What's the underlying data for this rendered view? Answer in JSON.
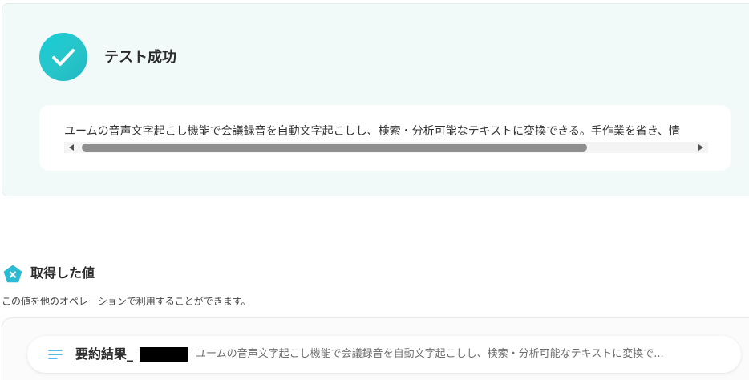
{
  "test_result": {
    "title": "テスト成功",
    "output_text": "ユームの音声文字起こし機能で会議録音を自動文字起こしし、検索・分析可能なテキストに変換できる。手作業を省き、情"
  },
  "acquired_values": {
    "title": "取得した値",
    "description": "この値を他のオペレーションで利用することができます。",
    "items": [
      {
        "key": "要約結果_",
        "preview": "ユームの音声文字起こし機能で会議録音を自動文字起こしし、検索・分析可能なテキストに変換で..."
      }
    ]
  },
  "colors": {
    "accent": "#1ecbd3",
    "panel_bg": "#f1f9f9"
  },
  "icons": {
    "success": "check-circle-icon",
    "section": "pentagon-x-icon",
    "value": "text-lines-icon"
  }
}
